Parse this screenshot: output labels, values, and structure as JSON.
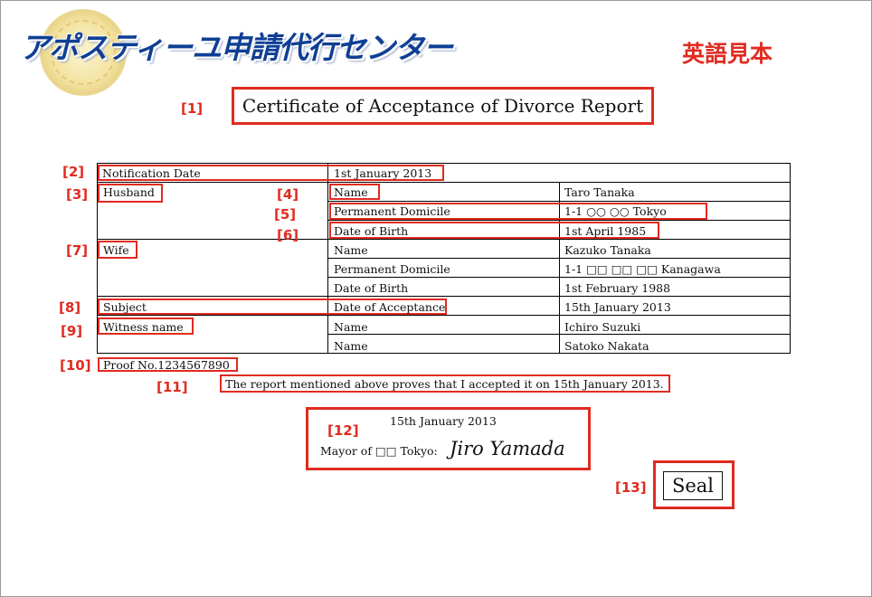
{
  "header": {
    "logo_text": "アポスティーユ申請代行センター",
    "sample_label": "英語見本"
  },
  "document": {
    "title": "Certificate of Acceptance of Divorce Report",
    "notification_date_label": "Notification Date",
    "notification_date_value": "1st January 2013",
    "husband_label": "Husband",
    "husband": {
      "name_label": "Name",
      "name": "Taro Tanaka",
      "domicile_label": "Permanent Domicile",
      "domicile": "1-1 ○○ ○○ Tokyo",
      "dob_label": "Date of Birth",
      "dob": "1st April 1985"
    },
    "wife_label": "Wife",
    "wife": {
      "name_label": "Name",
      "name": "Kazuko Tanaka",
      "domicile_label": "Permanent Domicile",
      "domicile": "1-1 □□ □□ □□ Kanagawa",
      "dob_label": "Date of Birth",
      "dob": "1st February 1988"
    },
    "subject_label": "Subject",
    "acceptance_label": "Date of Acceptance",
    "acceptance_date": "15th January 2013",
    "witness_label": "Witness name",
    "witnesses": [
      {
        "label": "Name",
        "value": "Ichiro Suzuki"
      },
      {
        "label": "Name",
        "value": "Satoko Nakata"
      }
    ],
    "proof_no": "Proof No.1234567890",
    "statement": "The report mentioned above proves that I accepted it on 15th January 2013.",
    "signature_date": "15th January 2013",
    "mayor_text": "Mayor of □□ Tokyo:",
    "mayor_signature": "Jiro Yamada",
    "seal_text": "Seal"
  },
  "markers": [
    "[1]",
    "[2]",
    "[3]",
    "[4]",
    "[5]",
    "[6]",
    "[7]",
    "[8]",
    "[9]",
    "[10]",
    "[11]",
    "[12]",
    "[13]"
  ],
  "colors": {
    "annotation": "#e02b20",
    "logo_blue": "#0f3f94",
    "border": "#000000"
  }
}
